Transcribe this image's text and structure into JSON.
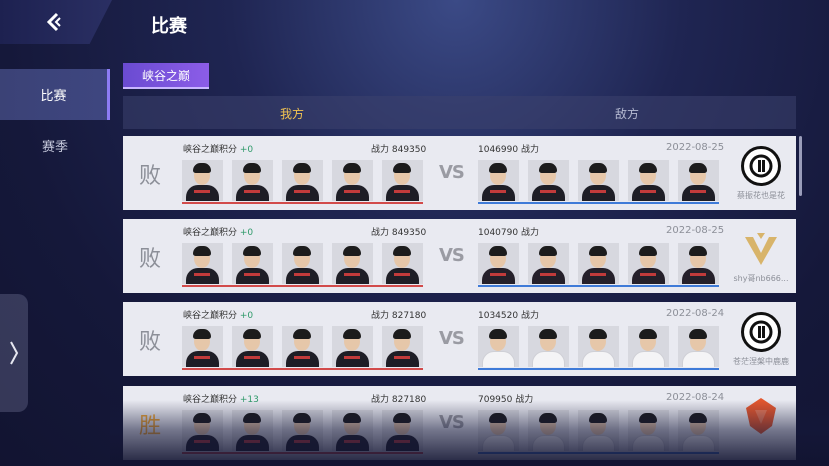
{
  "header": {
    "title": "比赛"
  },
  "nav": {
    "items": [
      "比赛",
      "赛季"
    ]
  },
  "mode_tag": "峡谷之巅",
  "columns": {
    "mine": "我方",
    "enemy": "敌方"
  },
  "matches": [
    {
      "result": "败",
      "win": false,
      "score_label": "峡谷之巅积分",
      "score_delta": "+0",
      "power_mine": "战力 849350",
      "power_enemy": "1046990 战力",
      "date": "2022-08-25",
      "opponent_name": "蔡振花也是花",
      "opponent_logo": "ig-logo",
      "enemy_jersey": "dark"
    },
    {
      "result": "败",
      "win": false,
      "score_label": "峡谷之巅积分",
      "score_delta": "+0",
      "power_mine": "战力 849350",
      "power_enemy": "1040790 战力",
      "date": "2022-08-25",
      "opponent_name": "shy哥nb666...",
      "opponent_logo": "v-logo",
      "enemy_jersey": "red"
    },
    {
      "result": "败",
      "win": false,
      "score_label": "峡谷之巅积分",
      "score_delta": "+0",
      "power_mine": "战力 827180",
      "power_enemy": "1034520 战力",
      "date": "2022-08-24",
      "opponent_name": "苍茫涅槃中鹿鹿",
      "opponent_logo": "ig-logo",
      "enemy_jersey": "white"
    },
    {
      "result": "胜",
      "win": true,
      "score_label": "峡谷之巅积分",
      "score_delta": "+13",
      "power_mine": "战力 827180",
      "power_enemy": "709950 战力",
      "date": "2022-08-24",
      "opponent_name": "",
      "opponent_logo": "tes-logo",
      "enemy_jersey": "white"
    }
  ],
  "vs_label": "VS",
  "colors": {
    "accent": "#8c5de8",
    "mine_bar": "#d24b4b",
    "enemy_bar": "#3f7bd8",
    "win": "#f0a635"
  }
}
